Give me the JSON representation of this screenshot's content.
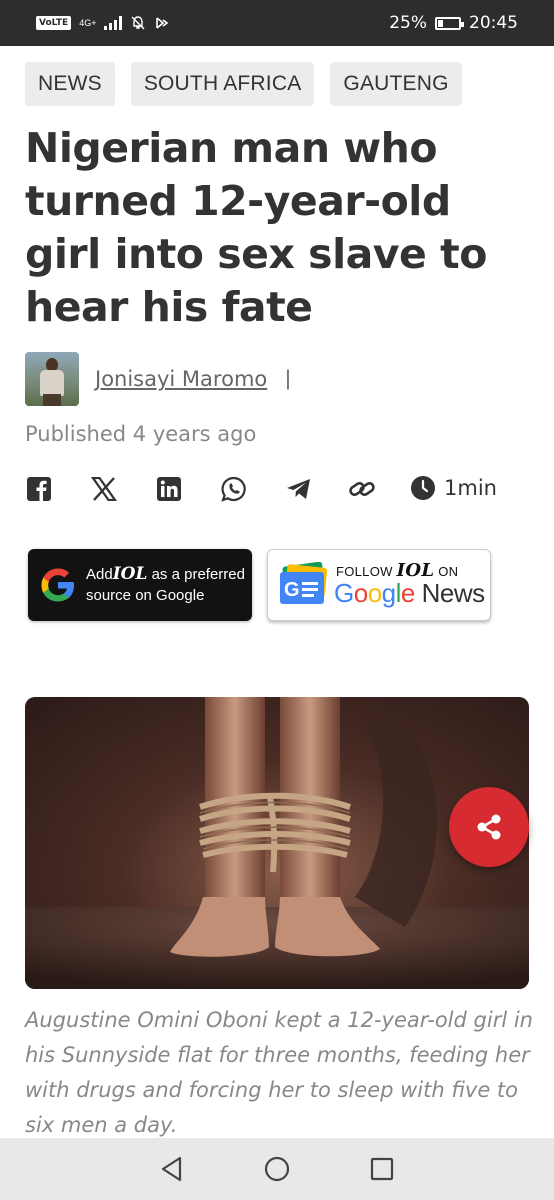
{
  "status_bar": {
    "volte": "VoLTE",
    "network": "4G+",
    "battery": "25%",
    "time": "20:45"
  },
  "tags": [
    "NEWS",
    "SOUTH AFRICA",
    "GAUTENG"
  ],
  "article": {
    "headline": "Nigerian man who turned 12-year-old girl into sex slave to hear his fate",
    "author": "Jonisayi Maromo",
    "separator": "|",
    "published": "Published 4 years ago",
    "read_time": "1min",
    "caption": "Augustine Omini Oboni kept a 12-year-old girl in his Sunnyside flat for three months, feeding her with drugs and forcing her to sleep with five to six men a day."
  },
  "share_icons": [
    "facebook-icon",
    "x-icon",
    "linkedin-icon",
    "whatsapp-icon",
    "telegram-icon",
    "link-icon"
  ],
  "badges": {
    "google_add": "Add",
    "google_brand": "IOL",
    "google_line1_suffix": "as a preferred",
    "google_line2": "source on Google",
    "gnews_follow": "FOLLOW",
    "gnews_brand": "IOL",
    "gnews_on": "ON",
    "gnews_google": "Google",
    "gnews_news": " News"
  },
  "colors": {
    "share_fab": "#d62b30",
    "status_bar": "#2d2d2d",
    "tag_bg": "#ececec"
  }
}
